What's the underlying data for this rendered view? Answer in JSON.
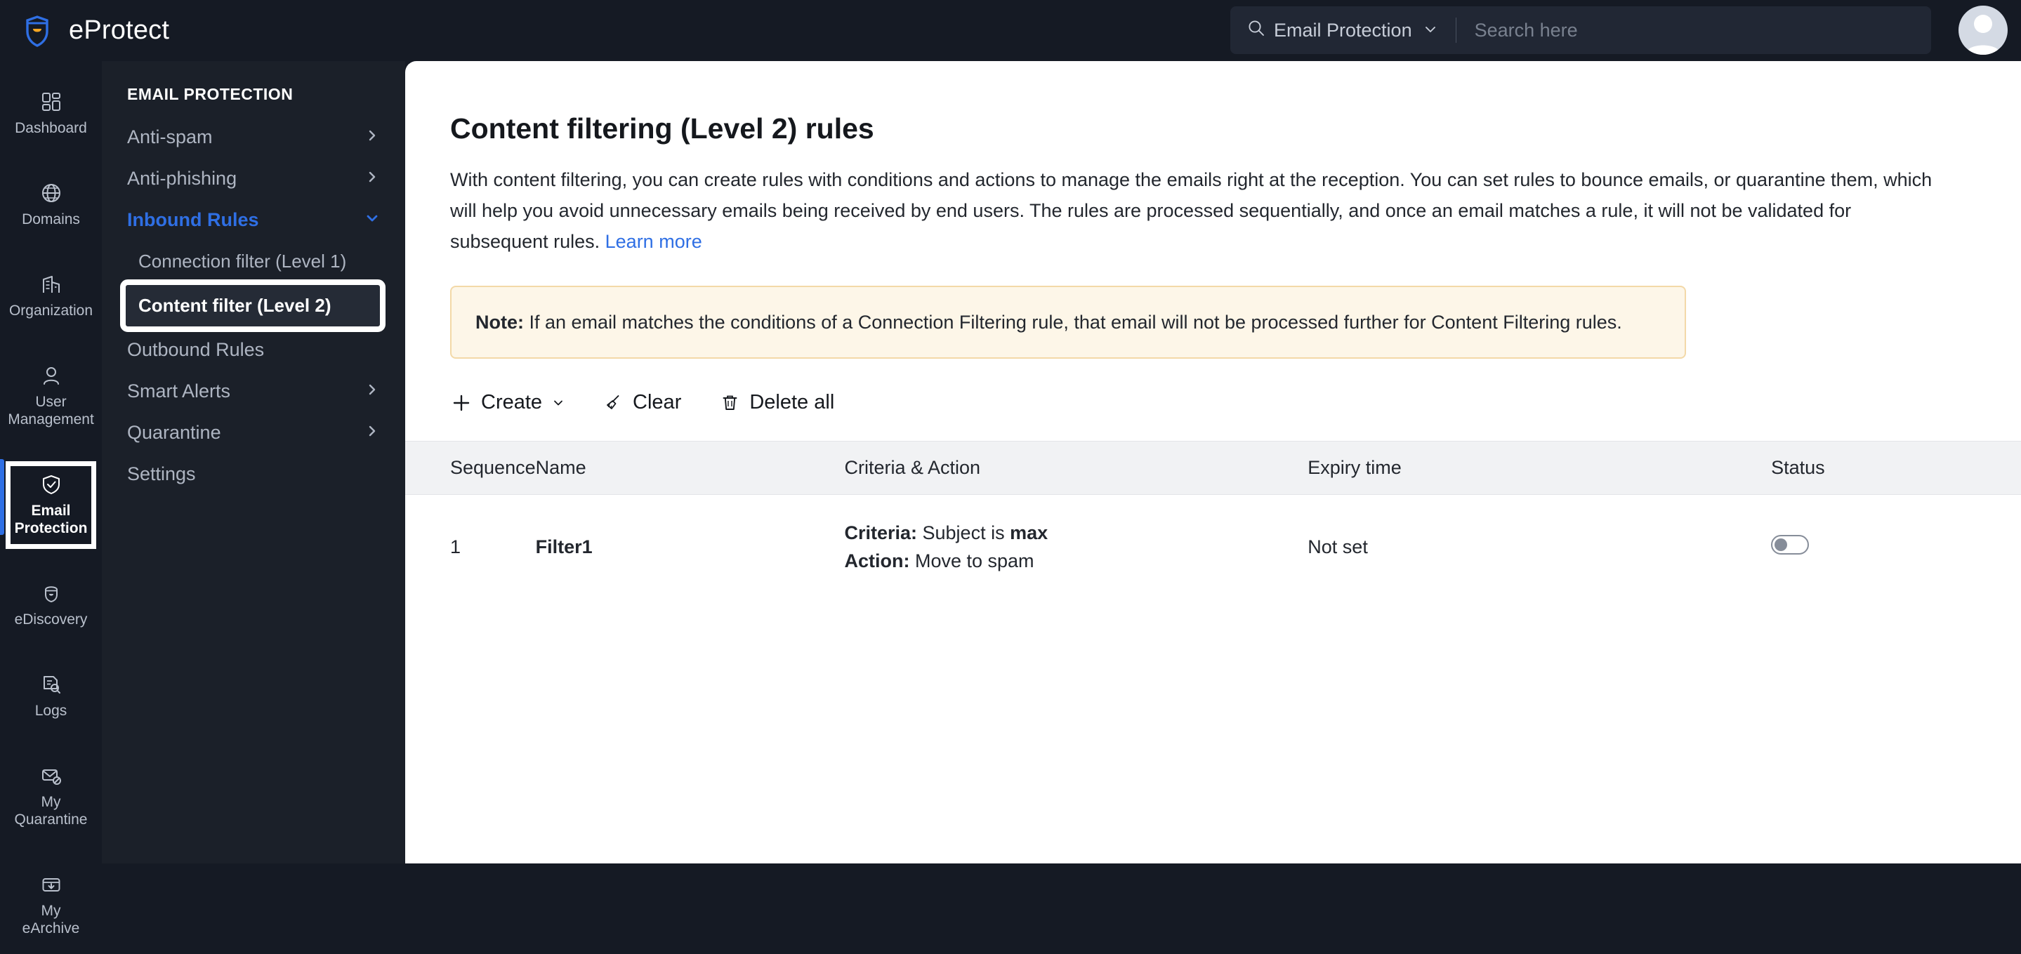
{
  "app": {
    "brand_name": "eProtect",
    "logo_icon": "shield-smile-logo"
  },
  "header": {
    "search_scope": "Email Protection",
    "search_placeholder": "Search here",
    "search_value": "",
    "search_icon": "search-icon",
    "scope_chevron_icon": "chevron-down-icon",
    "avatar_icon": "user-avatar"
  },
  "rail": {
    "items": [
      {
        "label": "Dashboard",
        "icon": "grid-icon",
        "active": false
      },
      {
        "label": "Domains",
        "icon": "globe-icon",
        "active": false
      },
      {
        "label": "Organization",
        "icon": "building-icon",
        "active": false
      },
      {
        "label": "User\nManagement",
        "icon": "user-icon",
        "active": false
      },
      {
        "label": "Email\nProtection",
        "icon": "shield-check-icon",
        "active": true
      },
      {
        "label": "eDiscovery",
        "icon": "helmet-icon",
        "active": false
      },
      {
        "label": "Logs",
        "icon": "document-search-icon",
        "active": false
      },
      {
        "label": "My\nQuarantine",
        "icon": "envelope-block-icon",
        "active": false
      },
      {
        "label": "My eArchive",
        "icon": "archive-download-icon",
        "active": false
      }
    ]
  },
  "sidebar": {
    "title": "EMAIL PROTECTION",
    "items": [
      {
        "label": "Anti-spam",
        "chevron": "chevron-right-icon",
        "state": "collapsed"
      },
      {
        "label": "Anti-phishing",
        "chevron": "chevron-right-icon",
        "state": "collapsed"
      },
      {
        "label": "Inbound Rules",
        "chevron": "chevron-down-icon",
        "state": "expanded"
      },
      {
        "label": "Connection filter (Level 1)",
        "state": "child"
      },
      {
        "label": "Content filter (Level 2)",
        "state": "child-selected"
      },
      {
        "label": "Outbound Rules",
        "state": "plain"
      },
      {
        "label": "Smart Alerts",
        "chevron": "chevron-right-icon",
        "state": "collapsed"
      },
      {
        "label": "Quarantine",
        "chevron": "chevron-right-icon",
        "state": "collapsed"
      },
      {
        "label": "Settings",
        "state": "plain"
      }
    ]
  },
  "main": {
    "title": "Content filtering (Level 2) rules",
    "description": "With content filtering, you can create rules with conditions and actions to manage the emails right at the reception. You can set rules to bounce emails, or quarantine them, which will help you avoid unnecessary emails being received by end users. The rules are processed sequentially, and once an email matches a rule, it will not be validated for subsequent rules. ",
    "learn_more": "Learn more",
    "note": {
      "label": "Note:",
      "text": " If an email matches the conditions of a Connection Filtering rule, that email will not be processed further for Content Filtering rules."
    },
    "toolbar": {
      "create_label": "Create",
      "create_icon": "plus-icon",
      "create_chevron": "chevron-down-icon",
      "clear_label": "Clear",
      "clear_icon": "broom-icon",
      "delete_all_label": "Delete all",
      "delete_all_icon": "trash-icon"
    },
    "table": {
      "columns": [
        "Sequence",
        "Name",
        "Criteria & Action",
        "Expiry time",
        "Status"
      ],
      "rows": [
        {
          "sequence": "1",
          "name": "Filter1",
          "criteria_label": "Criteria:",
          "criteria_text": " Subject is ",
          "criteria_value": "max",
          "action_label": "Action:",
          "action_text": " Move to spam",
          "expiry": "Not set",
          "status_enabled": false
        }
      ]
    }
  },
  "colors": {
    "rail_bg": "#151a24",
    "sidebar_bg": "#1b2029",
    "accent_blue": "#2f6fe4",
    "note_bg": "#fdf6e8",
    "note_border": "#f3d9a8",
    "table_header_bg": "#f1f2f4"
  }
}
